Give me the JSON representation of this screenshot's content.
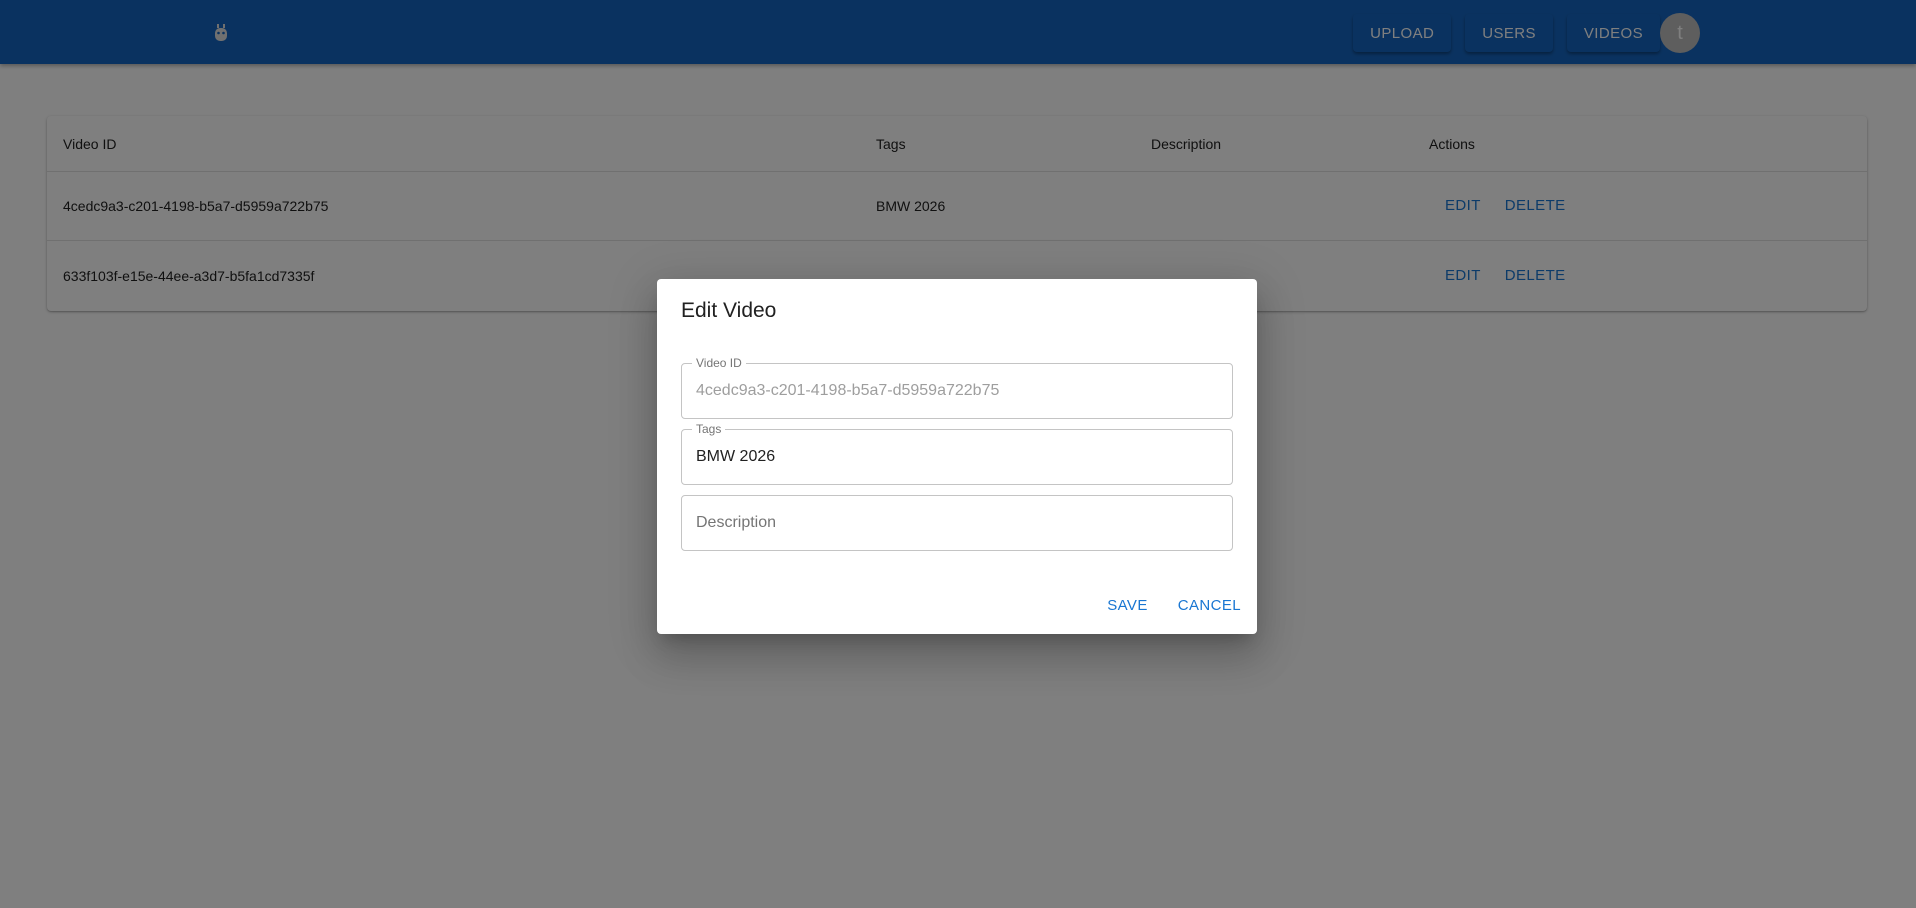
{
  "header": {
    "logo_icon": "robot-icon",
    "nav": {
      "upload": "UPLOAD",
      "users": "USERS",
      "videos": "VIDEOS"
    },
    "avatar_letter": "t",
    "accent_color": "#1565c0"
  },
  "table": {
    "columns": {
      "video_id": "Video ID",
      "tags": "Tags",
      "description": "Description",
      "actions": "Actions"
    },
    "rows": [
      {
        "video_id": "4cedc9a3-c201-4198-b5a7-d5959a722b75",
        "tags": "BMW 2026",
        "description": "",
        "edit": "EDIT",
        "delete": "DELETE"
      },
      {
        "video_id": "633f103f-e15e-44ee-a3d7-b5fa1cd7335f",
        "tags": "",
        "description": "",
        "edit": "EDIT",
        "delete": "DELETE"
      }
    ]
  },
  "dialog": {
    "title": "Edit Video",
    "fields": {
      "video_id": {
        "label": "Video ID",
        "value": "4cedc9a3-c201-4198-b5a7-d5959a722b75"
      },
      "tags": {
        "label": "Tags",
        "value": "BMW 2026"
      },
      "description": {
        "placeholder": "Description",
        "value": ""
      }
    },
    "save": "SAVE",
    "cancel": "CANCEL"
  }
}
